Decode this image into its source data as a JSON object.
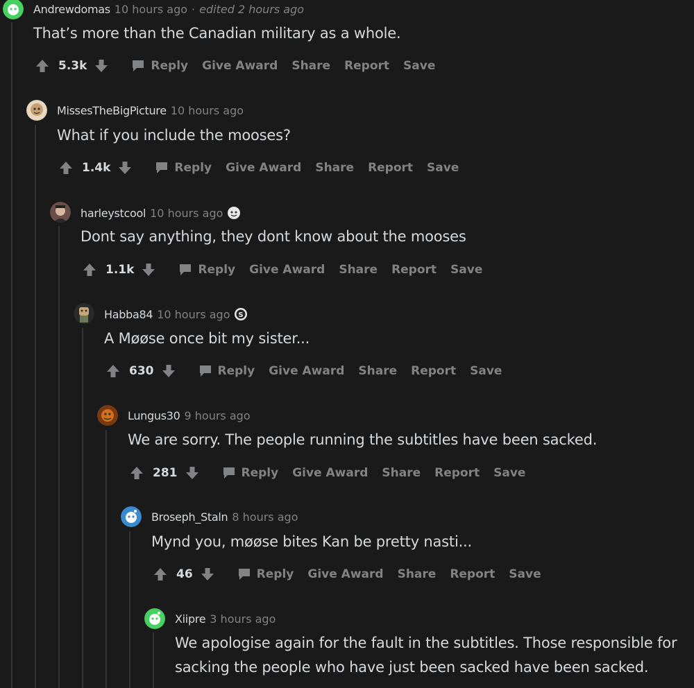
{
  "actions": {
    "reply": "Reply",
    "give_award": "Give Award",
    "share": "Share",
    "report": "Report",
    "save": "Save"
  },
  "comments": [
    {
      "author": "Andrewdomas",
      "time": "10 hours ago",
      "edited": "edited 2 hours ago",
      "body": "That’s more than the Canadian military as a whole.",
      "score": "5.3k",
      "avatar_color": "#46d160"
    },
    {
      "author": "MissesTheBigPicture",
      "time": "10 hours ago",
      "body": "What if you include the mooses?",
      "score": "1.4k",
      "avatar_color": "#c8a070"
    },
    {
      "author": "harleystcool",
      "time": "10 hours ago",
      "body": "Dont say anything, they dont know about the mooses",
      "score": "1.1k",
      "avatar_color": "#8a6a5a"
    },
    {
      "author": "Habba84",
      "time": "10 hours ago",
      "body": "A Møøse once bit my sister...",
      "score": "630",
      "avatar_color": "#b89860"
    },
    {
      "author": "Lungus30",
      "time": "9 hours ago",
      "body": "We are sorry. The people running the subtitles have been sacked.",
      "score": "281",
      "avatar_color": "#c06020"
    },
    {
      "author": "Broseph_Staln",
      "time": "8 hours ago",
      "body": "Mynd you, møøse bites Kan be pretty nasti...",
      "score": "46",
      "avatar_color": "#3a8ad0"
    },
    {
      "author": "Xiipre",
      "time": "3 hours ago",
      "body_lines": [
        "We apologise again for the fault in the subtitles. Those responsible for",
        "sacking the people who have just been sacked have been sacked."
      ],
      "avatar_color": "#46d160"
    }
  ]
}
